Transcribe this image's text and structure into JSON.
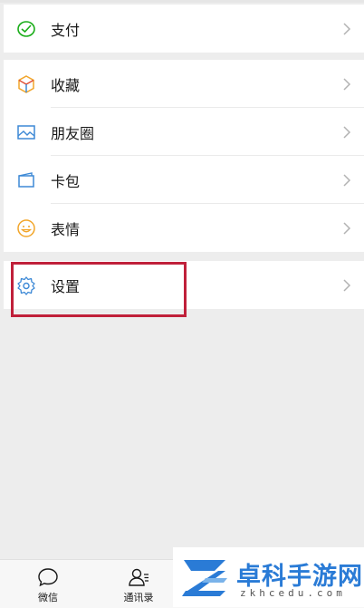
{
  "menu": {
    "pay": {
      "label": "支付",
      "icon": "pay-icon"
    },
    "favorites": {
      "label": "收藏",
      "icon": "favorites-cube-icon"
    },
    "moments": {
      "label": "朋友圈",
      "icon": "moments-image-icon"
    },
    "cards": {
      "label": "卡包",
      "icon": "card-wallet-icon"
    },
    "stickers": {
      "label": "表情",
      "icon": "smiley-icon"
    },
    "settings": {
      "label": "设置",
      "icon": "gear-icon"
    }
  },
  "tabbar": {
    "tabs": [
      {
        "label": "微信",
        "icon": "chat-bubble-icon"
      },
      {
        "label": "通讯录",
        "icon": "contacts-icon"
      }
    ]
  },
  "watermark": {
    "title": "卓科手游网",
    "url": "zkhcedu.com"
  },
  "colors": {
    "highlight": "#c0203a",
    "pay_green": "#1aad19",
    "watermark_blue": "#2a7bd6"
  }
}
